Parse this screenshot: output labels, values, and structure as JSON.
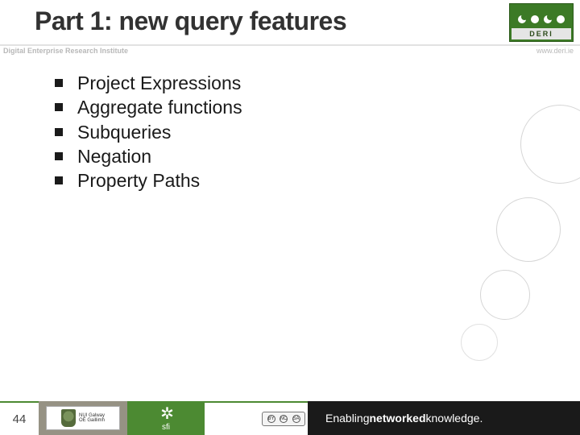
{
  "title": "Part 1: new query features",
  "institute": "Digital Enterprise Research Institute",
  "url": "www.deri.ie",
  "logo_text": "DERI",
  "bullets": [
    "Project Expressions",
    "Aggregate functions",
    "Subqueries",
    "Negation",
    "Property Paths"
  ],
  "footer": {
    "page": "44",
    "nui_line1": "NUI Galway",
    "nui_line2": "OÉ Gaillimh",
    "sfi": "sfi",
    "cc_by": "BY",
    "cc_nc": "NC",
    "cc_sa": "SA",
    "tagline_pre": "Enabling ",
    "tagline_bold": "networked",
    "tagline_post": " knowledge."
  }
}
